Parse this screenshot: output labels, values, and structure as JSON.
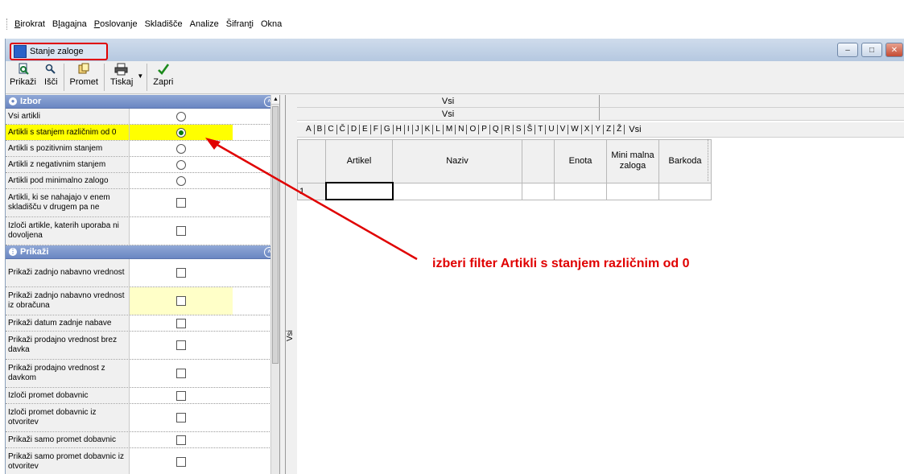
{
  "menubar": {
    "items": [
      {
        "pre": "",
        "u": "B",
        "post": "irokrat"
      },
      {
        "pre": "B",
        "u": "l",
        "post": "agajna"
      },
      {
        "pre": "",
        "u": "P",
        "post": "oslovanje"
      },
      {
        "pre": "",
        "u": "",
        "post": "Skladišče"
      },
      {
        "pre": "",
        "u": "",
        "post": "Analize"
      },
      {
        "pre": "Šifran",
        "u": "t",
        "post": "i"
      },
      {
        "pre": "",
        "u": "",
        "post": "Okna"
      }
    ]
  },
  "window": {
    "title": "Stanje zaloge"
  },
  "toolbar": {
    "prikazi": "Prikaži",
    "isci": "Išči",
    "promet": "Promet",
    "tiskaj": "Tiskaj",
    "zapri": "Zapri"
  },
  "izbor": {
    "header": "Izbor",
    "rows": [
      {
        "label": "Vsi artikli",
        "control": "radio",
        "checked": false
      },
      {
        "label": "Artikli s stanjem različnim od 0",
        "control": "radio",
        "checked": true
      },
      {
        "label": "Artikli s pozitivnim stanjem",
        "control": "radio",
        "checked": false
      },
      {
        "label": "Artikli z negativnim stanjem",
        "control": "radio",
        "checked": false
      },
      {
        "label": "Artikli pod minimalno zalogo",
        "control": "radio",
        "checked": false
      },
      {
        "label": "Artikli, ki se nahajajo v enem skladišču v drugem pa ne",
        "control": "checkbox",
        "checked": false
      },
      {
        "label": "Izloči artikle, katerih uporaba ni dovoljena",
        "control": "checkbox",
        "checked": false
      }
    ]
  },
  "prikazi": {
    "header": "Prikaži",
    "rows": [
      {
        "label": "Prikaži zadnjo nabavno vrednost"
      },
      {
        "label": "Prikaži zadnjo nabavno vrednost iz obračuna"
      },
      {
        "label": "Prikaži datum zadnje nabave"
      },
      {
        "label": "Prikaži prodajno vrednost brez davka"
      },
      {
        "label": "Prikaži prodajno vrednost z davkom"
      },
      {
        "label": "Izloči promet dobavnic"
      },
      {
        "label": "Izloči promet dobavnic iz otvoritev"
      },
      {
        "label": "Prikaži samo promet dobavnic"
      },
      {
        "label": "Prikaži samo promet dobavnic iz otvoritev"
      }
    ]
  },
  "vtab": {
    "label": "Vsi"
  },
  "grid": {
    "header1": "Vsi",
    "header2": "Vsi",
    "letters": [
      "A",
      "B",
      "C",
      "Č",
      "D",
      "E",
      "F",
      "G",
      "H",
      "I",
      "J",
      "K",
      "L",
      "M",
      "N",
      "O",
      "P",
      "Q",
      "R",
      "S",
      "Š",
      "T",
      "U",
      "V",
      "W",
      "X",
      "Y",
      "Z",
      "Ž",
      "Vsi"
    ],
    "columns": [
      "",
      "Artikel",
      "Naziv",
      "",
      "Enota",
      "Mini malna zaloga",
      "Barkoda"
    ],
    "row_number": "1"
  },
  "annotation": {
    "text": "izberi filter Artikli s stanjem različnim od 0",
    "color": "#e00000"
  }
}
